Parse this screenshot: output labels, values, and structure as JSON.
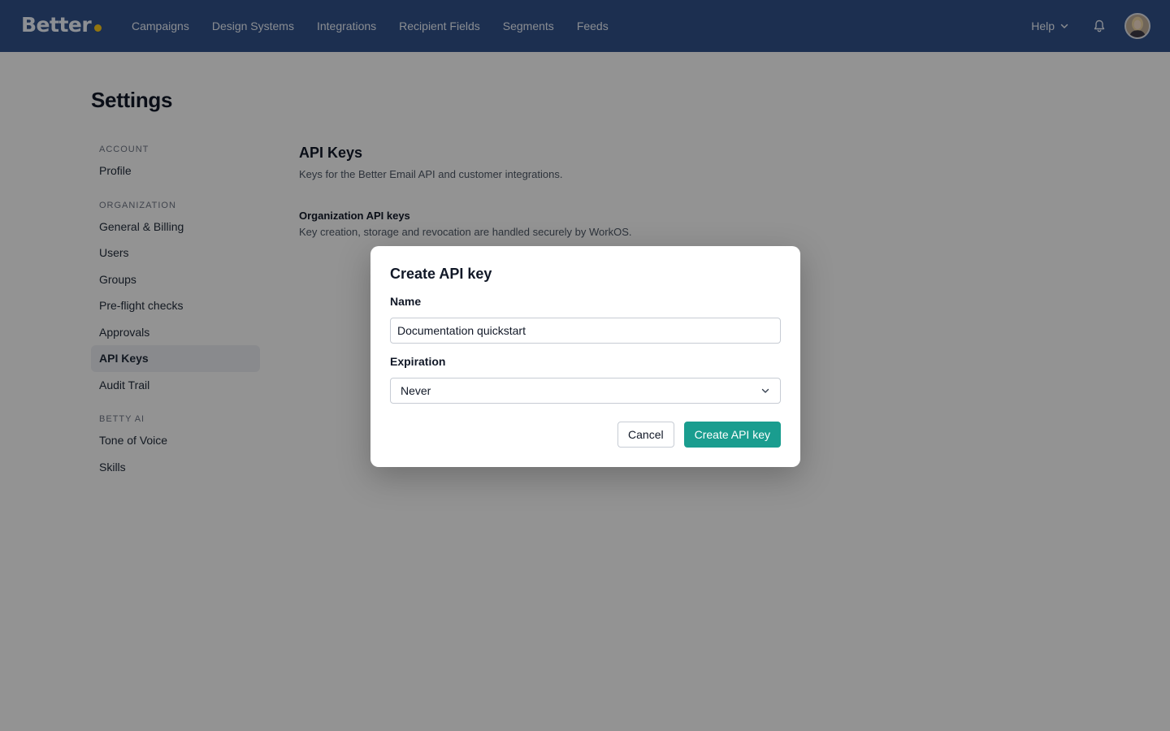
{
  "brand": {
    "logo_text": "Better",
    "dot_color": "#f4c31a",
    "nav_color": "#2f4f86"
  },
  "nav": {
    "items": [
      "Campaigns",
      "Design Systems",
      "Integrations",
      "Recipient Fields",
      "Segments",
      "Feeds"
    ],
    "help_label": "Help",
    "help_icon": "chevron-down-icon",
    "bell_icon": "bell-icon"
  },
  "page": {
    "title": "Settings"
  },
  "sidebar": {
    "sections": [
      {
        "heading": "ACCOUNT",
        "items": [
          "Profile"
        ]
      },
      {
        "heading": "ORGANIZATION",
        "items": [
          "General & Billing",
          "Users",
          "Groups",
          "Pre-flight checks",
          "Approvals",
          "API Keys",
          "Audit Trail"
        ]
      },
      {
        "heading": "BETTY AI",
        "items": [
          "Tone of Voice",
          "Skills"
        ]
      }
    ],
    "active_item": "API Keys"
  },
  "content": {
    "title": "API Keys",
    "description": "Keys for the Better Email API and customer integrations.",
    "sub_title": "Organization API keys",
    "sub_description": "Key creation, storage and revocation are handled securely by WorkOS."
  },
  "modal": {
    "title": "Create API key",
    "name_label": "Name",
    "name_value": "Documentation quickstart",
    "expiration_label": "Expiration",
    "expiration_value": "Never",
    "cancel_label": "Cancel",
    "submit_label": "Create API key",
    "accent_color": "#1a9d8f"
  }
}
